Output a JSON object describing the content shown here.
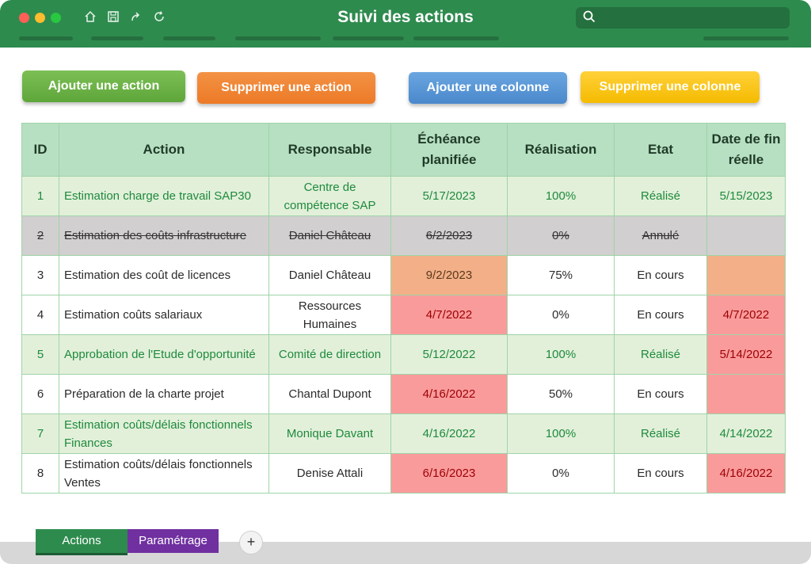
{
  "window": {
    "title": "Suivi des actions"
  },
  "toolbar": {
    "icons": [
      "home-icon",
      "save-icon",
      "share-icon",
      "refresh-icon"
    ],
    "search_icon": "search-icon"
  },
  "buttons": {
    "add_action": "Ajouter une action",
    "delete_action": "Supprimer une action",
    "add_column": "Ajouter une colonne",
    "delete_column": "Supprimer une colonne"
  },
  "table": {
    "headers": [
      "ID",
      "Action",
      "Responsable",
      "Échéance planifiée",
      "Réalisation",
      "Etat",
      "Date de fin réelle"
    ],
    "rows": [
      {
        "id": "1",
        "action": "Estimation charge de travail SAP30",
        "responsable": "Centre de compétence SAP",
        "echeance": "5/17/2023",
        "realisation": "100%",
        "etat": "Réalisé",
        "date_fin": "5/15/2023",
        "status": "done"
      },
      {
        "id": "2",
        "action": "Estimation des coûts infrastructure",
        "responsable": "Daniel Château",
        "echeance": "6/2/2023",
        "realisation": "0%",
        "etat": "Annulé",
        "date_fin": "",
        "status": "cancel"
      },
      {
        "id": "3",
        "action": "Estimation des coût de licences",
        "responsable": "Daniel Château",
        "echeance": "9/2/2023",
        "realisation": "75%",
        "etat": "En cours",
        "date_fin": "",
        "status": "normal"
      },
      {
        "id": "4",
        "action": "Estimation coûts salariaux",
        "responsable": "Ressources Humaines",
        "echeance": "4/7/2022",
        "realisation": "0%",
        "etat": "En cours",
        "date_fin": "4/7/2022",
        "status": "normal"
      },
      {
        "id": "5",
        "action": "Approbation de l'Etude d'opportunité",
        "responsable": "Comité de direction",
        "echeance": "5/12/2022",
        "realisation": "100%",
        "etat": "Réalisé",
        "date_fin": "5/14/2022",
        "status": "done"
      },
      {
        "id": "6",
        "action": "Préparation de la charte projet",
        "responsable": "Chantal Dupont",
        "echeance": "4/16/2022",
        "realisation": "50%",
        "etat": "En cours",
        "date_fin": "",
        "status": "normal"
      },
      {
        "id": "7",
        "action": "Estimation coûts/délais fonctionnels Finances",
        "responsable": "Monique Davant",
        "echeance": "4/16/2022",
        "realisation": "100%",
        "etat": "Réalisé",
        "date_fin": "4/14/2022",
        "status": "done"
      },
      {
        "id": "8",
        "action": "Estimation coûts/délais fonctionnels Ventes",
        "responsable": "Denise Attali",
        "echeance": "6/16/2023",
        "realisation": "0%",
        "etat": "En cours",
        "date_fin": "4/16/2022",
        "status": "normal"
      }
    ]
  },
  "sheet_tabs": {
    "actions": "Actions",
    "parametrage": "Paramétrage",
    "add": "+"
  },
  "colors": {
    "titlebar": "#2e8b4e",
    "done_row": "#e2f0da",
    "done_text": "#1e8a3c",
    "cancel_row": "#d1cfcf",
    "late": "#fa9b9b",
    "warning": "#f3b088",
    "param_tab": "#7030a0"
  }
}
